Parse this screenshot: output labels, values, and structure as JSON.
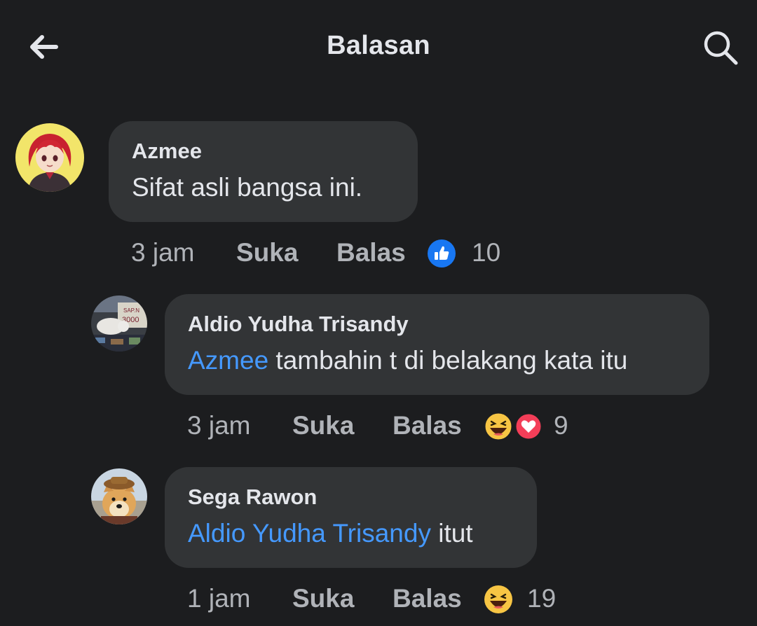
{
  "header": {
    "title": "Balasan",
    "back_icon": "arrow-left-icon",
    "search_icon": "search-icon"
  },
  "comments": [
    {
      "author": "Azmee",
      "text": "Sifat asli bangsa ini.",
      "time": "3 jam",
      "like_label": "Suka",
      "reply_label": "Balas",
      "reactions": [
        "like"
      ],
      "reaction_count": "10"
    },
    {
      "author": "Aldio Yudha Trisandy",
      "mention": "Azmee",
      "text": " tambahin t di belakang kata itu",
      "time": "3 jam",
      "like_label": "Suka",
      "reply_label": "Balas",
      "reactions": [
        "haha",
        "love"
      ],
      "reaction_count": "9"
    },
    {
      "author": "Sega Rawon",
      "mention": "Aldio Yudha Trisandy",
      "text": " itut",
      "time": "1 jam",
      "like_label": "Suka",
      "reply_label": "Balas",
      "reactions": [
        "haha"
      ],
      "reaction_count": "19"
    }
  ],
  "colors": {
    "background": "#1c1d1f",
    "bubble": "#323436",
    "text": "#e4e6eb",
    "secondary_text": "#b0b3b8",
    "mention": "#4599ff",
    "like_blue": "#1877f2",
    "love_red": "#f33e58",
    "haha_yellow": "#f7c544"
  }
}
